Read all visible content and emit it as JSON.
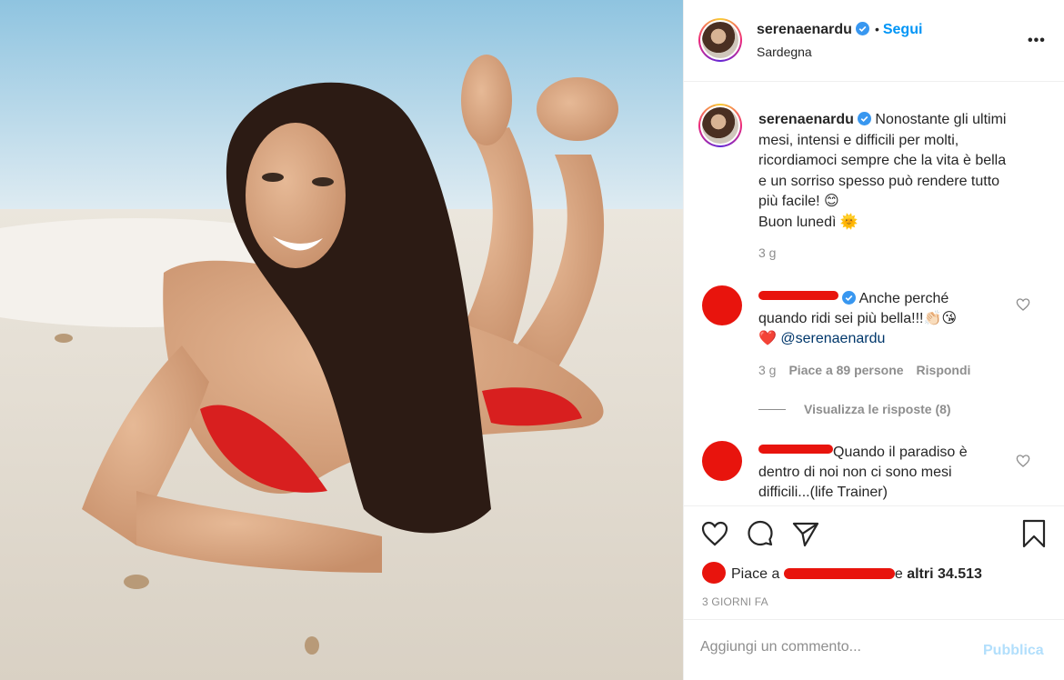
{
  "post": {
    "image_alt": "Woman lying on sandy beach in red bikini",
    "username": "serenaenardu",
    "follow_label": "Segui",
    "separator": "•",
    "location": "Sardegna",
    "more_label": "•••"
  },
  "caption": {
    "username": "serenaenardu",
    "text_lines": [
      "Nonostante gli ultimi",
      "mesi, intensi e difficili per molti,",
      "ricordiamoci sempre che la vita è bella",
      "e un sorriso spesso può rendere tutto",
      "più facile! 😊",
      "Buon lunedì 🌞"
    ],
    "time": "3 g"
  },
  "comments": [
    {
      "text_lines": [
        "Anche perché",
        "quando ridi sei più bella!!!👏🏻😘",
        "❤️ "
      ],
      "mention": "@serenaenardu",
      "time": "3 g",
      "likes": "Piace a 89 persone",
      "reply_label": "Rispondi",
      "view_replies": "Visualizza le risposte (8)"
    },
    {
      "text_lines": [
        "Quando il paradiso è",
        "dentro di noi non ci sono mesi",
        "difficili...(life Trainer)"
      ]
    }
  ],
  "likes": {
    "prefix": "Piace a",
    "suffix": "e",
    "others": "altri 34.513"
  },
  "date": "3 GIORNI FA",
  "add_comment": {
    "placeholder": "Aggiungi un commento...",
    "publish_label": "Pubblica"
  },
  "colors": {
    "accent": "#0095f6",
    "verified": "#3897f0",
    "redaction": "#e8140d",
    "publish_disabled": "#b2dffc"
  }
}
